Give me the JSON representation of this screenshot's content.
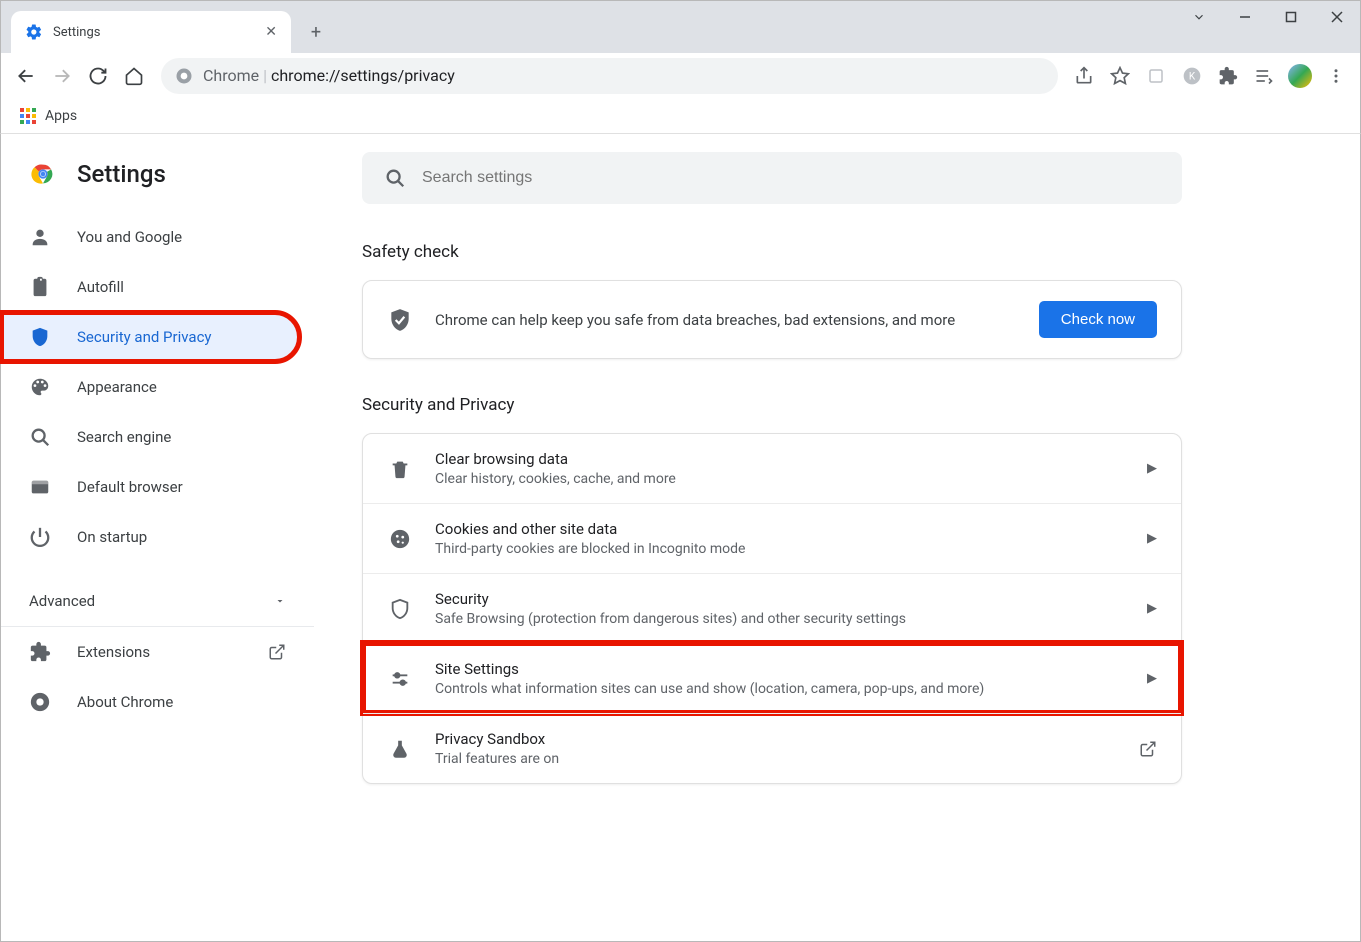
{
  "window": {
    "tab_title": "Settings",
    "url_scheme": "Chrome",
    "url_path": "chrome://settings/privacy",
    "bookmark_apps": "Apps"
  },
  "brand": {
    "title": "Settings"
  },
  "search": {
    "placeholder": "Search settings"
  },
  "sidebar": {
    "items": [
      {
        "label": "You and Google"
      },
      {
        "label": "Autofill"
      },
      {
        "label": "Security and Privacy"
      },
      {
        "label": "Appearance"
      },
      {
        "label": "Search engine"
      },
      {
        "label": "Default browser"
      },
      {
        "label": "On startup"
      }
    ],
    "advanced": "Advanced",
    "extensions": "Extensions",
    "about": "About Chrome"
  },
  "sections": {
    "safety_title": "Safety check",
    "safety_text": "Chrome can help keep you safe from data breaches, bad extensions, and more",
    "check_now": "Check now",
    "sp_title": "Security and Privacy",
    "rows": [
      {
        "title": "Clear browsing data",
        "sub": "Clear history, cookies, cache, and more"
      },
      {
        "title": "Cookies and other site data",
        "sub": "Third-party cookies are blocked in Incognito mode"
      },
      {
        "title": "Security",
        "sub": "Safe Browsing (protection from dangerous sites) and other security settings"
      },
      {
        "title": "Site Settings",
        "sub": "Controls what information sites can use and show (location, camera, pop-ups, and more)"
      },
      {
        "title": "Privacy Sandbox",
        "sub": "Trial features are on"
      }
    ]
  }
}
